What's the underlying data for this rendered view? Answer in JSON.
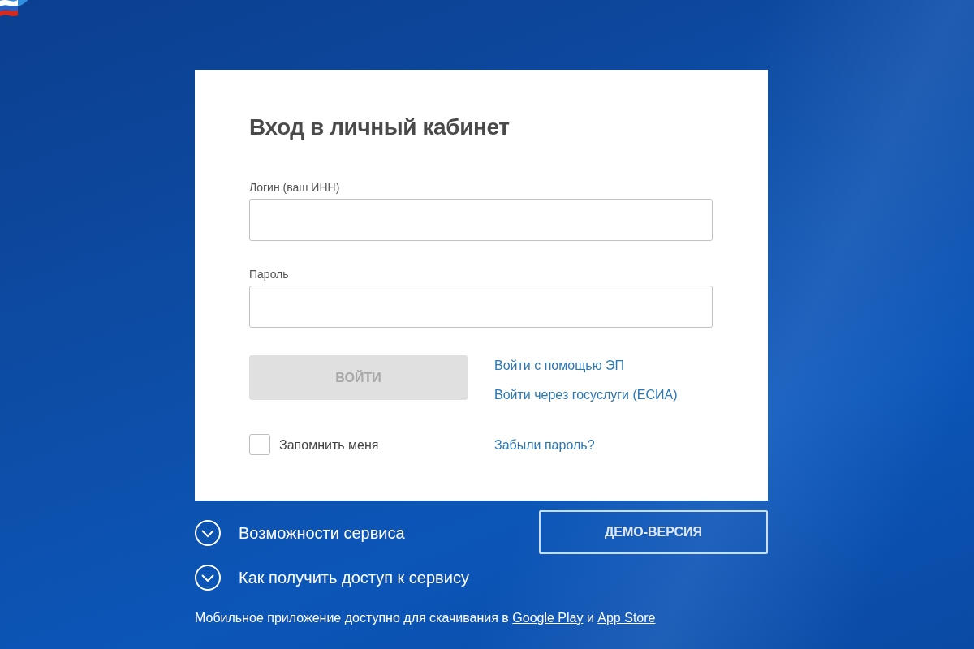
{
  "login_card": {
    "title": "Вход в личный кабинет",
    "fields": [
      {
        "label": "Логин (ваш ИНН)"
      },
      {
        "label": "Пароль"
      }
    ],
    "submit_button": {
      "label": "ВОЙТИ",
      "disabled": true
    },
    "sign_in_links": [
      "Войти с помощью ЭП",
      "Войти через госуслуги (ЕСИА)"
    ],
    "remember_me": {
      "label": "Запомнить меня",
      "checked": false
    },
    "forgot_link": "Забыли пароль?"
  },
  "info_sections": [
    {
      "label": "Возможности сервиса",
      "expanded": false
    },
    {
      "label": "Как получить доступ к сервису",
      "expanded": false
    }
  ],
  "demo_button": "ДЕМО-ВЕРСИЯ",
  "footer": {
    "parts": [
      {
        "kind": "text",
        "text": "Мобильное приложение доступно для скачивания в "
      },
      {
        "kind": "link",
        "text": "Google Play"
      },
      {
        "kind": "text",
        "text": " и "
      },
      {
        "kind": "link",
        "text": "App Store"
      }
    ]
  }
}
